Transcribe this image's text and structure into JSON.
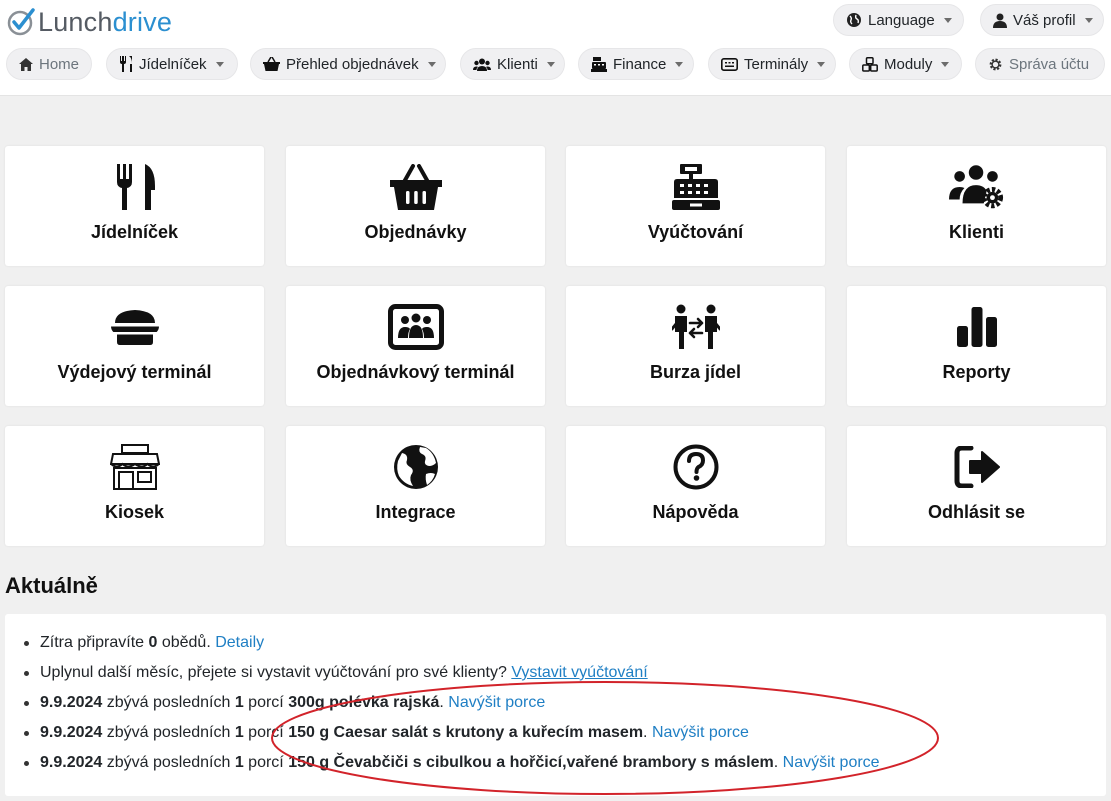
{
  "brand": {
    "part1": "Lunch",
    "part2": "drive"
  },
  "topbar": {
    "language": "Language",
    "profile": "Váš profil"
  },
  "nav": [
    {
      "label": "Home",
      "icon": "home-icon",
      "dropdown": false,
      "muted": true
    },
    {
      "label": "Jídelníček",
      "icon": "utensils-icon",
      "dropdown": true
    },
    {
      "label": "Přehled objednávek",
      "icon": "basket-icon",
      "dropdown": true
    },
    {
      "label": "Klienti",
      "icon": "users-icon",
      "dropdown": true
    },
    {
      "label": "Finance",
      "icon": "cash-register-icon",
      "dropdown": true
    },
    {
      "label": "Terminály",
      "icon": "terminal-icon",
      "dropdown": true
    },
    {
      "label": "Moduly",
      "icon": "cubes-icon",
      "dropdown": true
    },
    {
      "label": "Správa účtu",
      "icon": "gear-icon",
      "dropdown": false,
      "muted": true
    }
  ],
  "tiles": [
    {
      "label": "Jídelníček",
      "icon": "utensils-icon"
    },
    {
      "label": "Objednávky",
      "icon": "basket-icon"
    },
    {
      "label": "Vyúčtování",
      "icon": "cash-register-icon"
    },
    {
      "label": "Klienti",
      "icon": "users-gear-icon"
    },
    {
      "label": "Výdejový terminál",
      "icon": "bowl-food-icon"
    },
    {
      "label": "Objednávkový terminál",
      "icon": "people-screen-icon"
    },
    {
      "label": "Burza jídel",
      "icon": "people-exchange-icon"
    },
    {
      "label": "Reporty",
      "icon": "bar-chart-icon"
    },
    {
      "label": "Kiosek",
      "icon": "shop-icon"
    },
    {
      "label": "Integrace",
      "icon": "globe-icon"
    },
    {
      "label": "Nápověda",
      "icon": "question-circle-icon"
    },
    {
      "label": "Odhlásit se",
      "icon": "sign-out-icon"
    }
  ],
  "news": {
    "title": "Aktuálně",
    "items": [
      {
        "t1": "Zítra připravíte ",
        "b1": "0",
        "t2": " obědů. ",
        "link": "Detaily"
      },
      {
        "t1": "Uplynul další měsíc, přejete si vystavit vyúčtování pro své klienty? ",
        "link": "Vystavit vyúčtování"
      },
      {
        "date": "9.9.2024",
        "t1": " zbývá posledních ",
        "b1": "1",
        "t2": " porcí ",
        "food": "300g polévka rajská",
        "t3": ". ",
        "link": "Navýšit porce"
      },
      {
        "date": "9.9.2024",
        "t1": " zbývá posledních ",
        "b1": "1",
        "t2": " porcí ",
        "food": "150 g Caesar salát s krutony a kuřecím masem",
        "t3": ". ",
        "link": "Navýšit porce"
      },
      {
        "date": "9.9.2024",
        "t1": " zbývá posledních ",
        "b1": "1",
        "t2": " porcí ",
        "food": "150 g Čevabčiči s cibulkou a hořčicí,vařené brambory s máslem",
        "t3": ". ",
        "link": "Navýšit porce"
      }
    ]
  },
  "colors": {
    "brand_blue": "#2b8fd0",
    "link": "#1f7fc4",
    "annotation": "#d2232a"
  }
}
